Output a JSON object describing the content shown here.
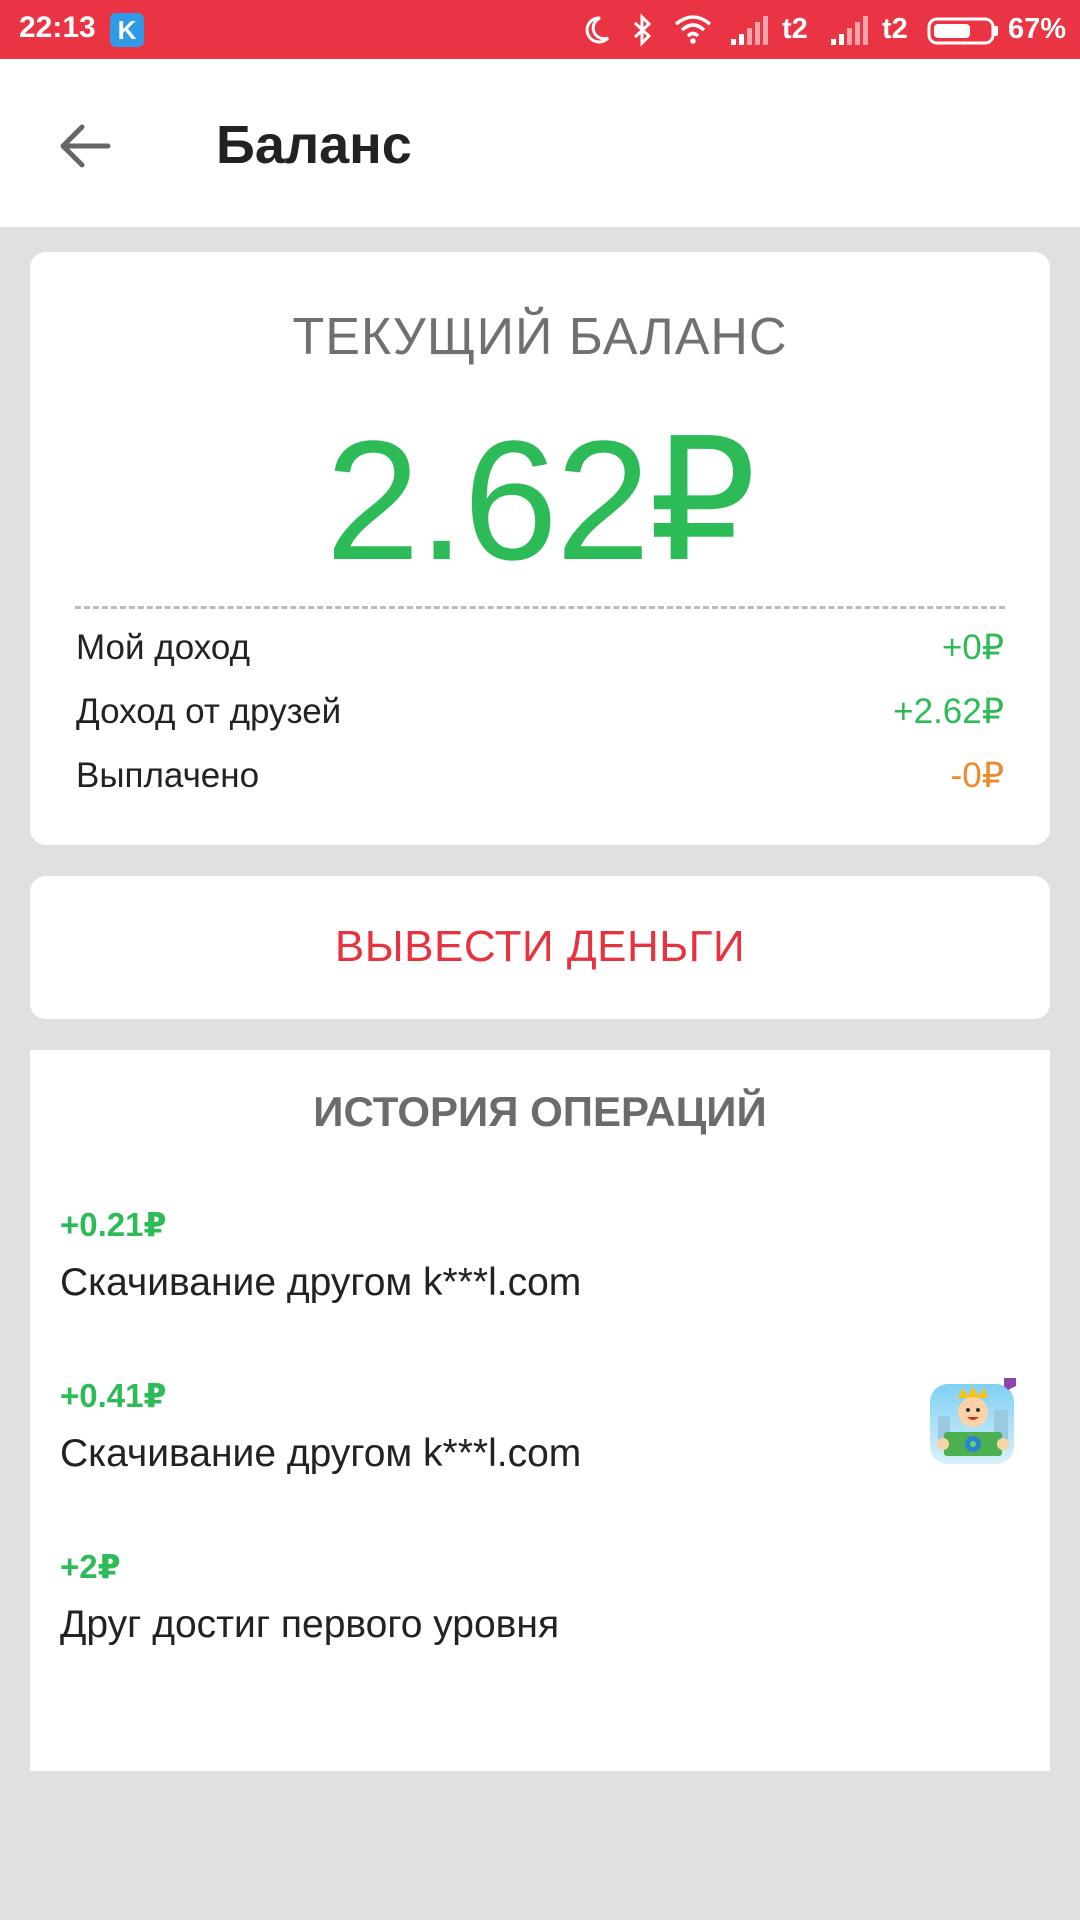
{
  "status_bar": {
    "time": "22:13",
    "app_badge": "K",
    "carrier1": "t2",
    "carrier2": "t2",
    "battery": "67%",
    "battery_level": 0.67,
    "icons": [
      "moon-icon",
      "bluetooth-icon",
      "wifi-icon",
      "signal-icon",
      "signal-icon",
      "battery-icon"
    ]
  },
  "app_bar": {
    "title": "Баланс",
    "back_icon": "arrow-back-icon"
  },
  "balance": {
    "label": "ТЕКУЩИЙ БАЛАНС",
    "value": "2.62₽",
    "rows": [
      {
        "label": "Мой доход",
        "value": "+0₽",
        "color": "#2dbb57"
      },
      {
        "label": "Доход от друзей",
        "value": "+2.62₽",
        "color": "#2dbb57"
      },
      {
        "label": "Выплачено",
        "value": "-0₽",
        "color": "#ee8a2a"
      }
    ]
  },
  "withdraw": {
    "label": "ВЫВЕСТИ ДЕНЬГИ"
  },
  "history": {
    "title": "ИСТОРИЯ ОПЕРАЦИЙ",
    "items": [
      {
        "amount": "+0.21₽",
        "description": "Скачивание другом k***l.com"
      },
      {
        "amount": "+0.41₽",
        "description": "Скачивание другом k***l.com"
      },
      {
        "amount": "+2₽",
        "description": "Друг достиг первого уровня"
      }
    ]
  },
  "colors": {
    "status_bar": "#ea3443",
    "accent_green": "#2dbb57",
    "accent_red": "#e7323f",
    "accent_orange": "#ee8a2a",
    "background": "#e0e0e0"
  }
}
